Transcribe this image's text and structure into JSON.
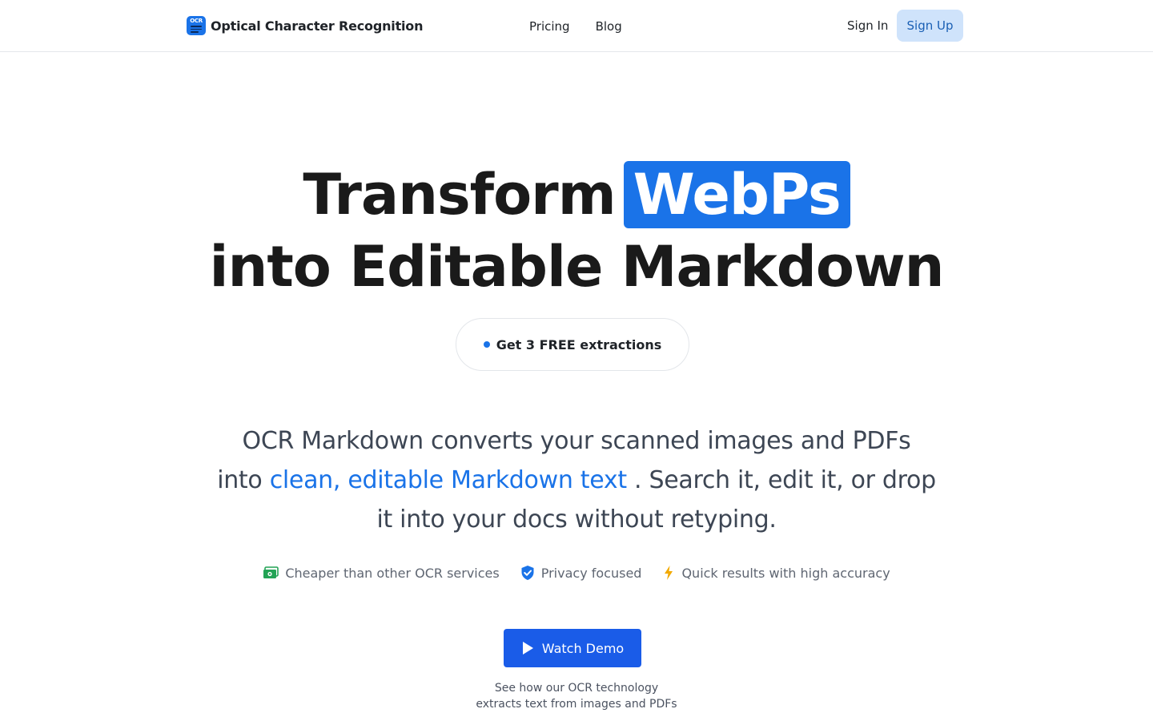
{
  "header": {
    "brand_logo_text": "OCR",
    "brand_name": "Optical Character Recognition",
    "nav": [
      {
        "label": "Pricing"
      },
      {
        "label": "Blog"
      }
    ],
    "sign_in": "Sign In",
    "sign_up": "Sign Up"
  },
  "hero": {
    "title_word": "Transform",
    "title_highlight": "WebPs",
    "title_line2": "into Editable Markdown",
    "pill": "Get 3 FREE extractions"
  },
  "description": {
    "part1": "OCR Markdown converts your scanned images and PDFs into ",
    "link": "clean, editable Markdown text",
    "part2": " . Search it, edit it, or drop it into your docs without retyping."
  },
  "features": [
    {
      "icon": "money-icon",
      "label": "Cheaper than other OCR services"
    },
    {
      "icon": "shield-check-icon",
      "label": "Privacy focused"
    },
    {
      "icon": "lightning-icon",
      "label": "Quick results with high accuracy"
    }
  ],
  "demo": {
    "button": "Watch Demo",
    "caption_line1": "See how our OCR technology",
    "caption_line2": "extracts text from images and PDFs"
  },
  "colors": {
    "accent": "#1a73e8",
    "button_blue": "#1a5ce8",
    "signup_bg": "#cfe3fb",
    "money_green": "#22a355",
    "shield_blue": "#1a73e8",
    "bolt_amber": "#f2a900"
  }
}
